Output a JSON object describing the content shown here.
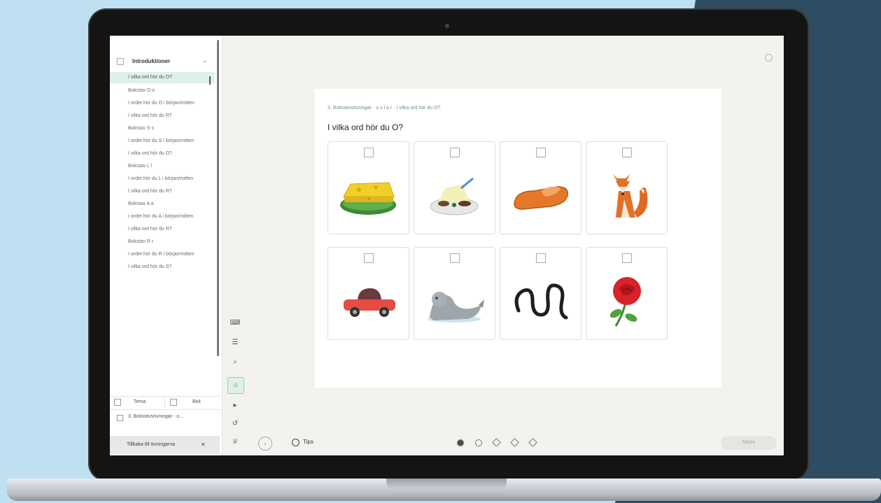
{
  "colors": {
    "background_left": "#bfe0f1",
    "background_right": "#2f4d62",
    "accent_active": "#dff0ea"
  },
  "sidebar": {
    "header_label": "Introduktioner",
    "items": [
      {
        "label": "I vilka ord hör du O?",
        "active": true
      },
      {
        "label": "Bokstav O o",
        "active": false
      },
      {
        "label": "I ordet hör du O i början/mitten",
        "active": false
      },
      {
        "label": "I vilka ord hör du R?",
        "active": false
      },
      {
        "label": "Bokstav S s",
        "active": false
      },
      {
        "label": "I ordet hör du S i början/mitten",
        "active": false
      },
      {
        "label": "I vilka ord hör du O?",
        "active": false
      },
      {
        "label": "Bokstav L l",
        "active": false
      },
      {
        "label": "I ordet hör du L i början/mitten",
        "active": false
      },
      {
        "label": "I vilka ord hör du R?",
        "active": false
      },
      {
        "label": "Bokstav A a",
        "active": false
      },
      {
        "label": "I ordet hör du A i början/mitten",
        "active": false
      },
      {
        "label": "I vilka ord hör du R?",
        "active": false
      },
      {
        "label": "Bokstav R r",
        "active": false
      },
      {
        "label": "I ordet hör du R i början/mitten",
        "active": false
      },
      {
        "label": "I vilka ord hör du S?",
        "active": false
      }
    ],
    "tabs": [
      "Tema",
      "Bok"
    ],
    "crumb": "3. Bokstavsövningar - o...",
    "bottom_button": "Tillbaka till övningarna"
  },
  "rail_icons": [
    "keyboard-icon",
    "list-icon",
    "search-icon",
    "home-icon",
    "play-icon",
    "undo-icon",
    "trophy-icon"
  ],
  "card": {
    "breadcrumb": "3. Bokstavsövningar · o s l a r · I vilka ord hör du O?",
    "question": "I vilka ord hör du O?",
    "tiles": [
      {
        "icon": "cheese-icon"
      },
      {
        "icon": "porridge-icon"
      },
      {
        "icon": "slipper-icon"
      },
      {
        "icon": "fox-icon"
      },
      {
        "icon": "car-icon"
      },
      {
        "icon": "seal-icon"
      },
      {
        "icon": "snake-icon"
      },
      {
        "icon": "rose-icon"
      }
    ]
  },
  "bottom_bar": {
    "tips_label": "Tips",
    "progress_step": 1,
    "progress_total": 5,
    "next_label": "Nästa"
  }
}
